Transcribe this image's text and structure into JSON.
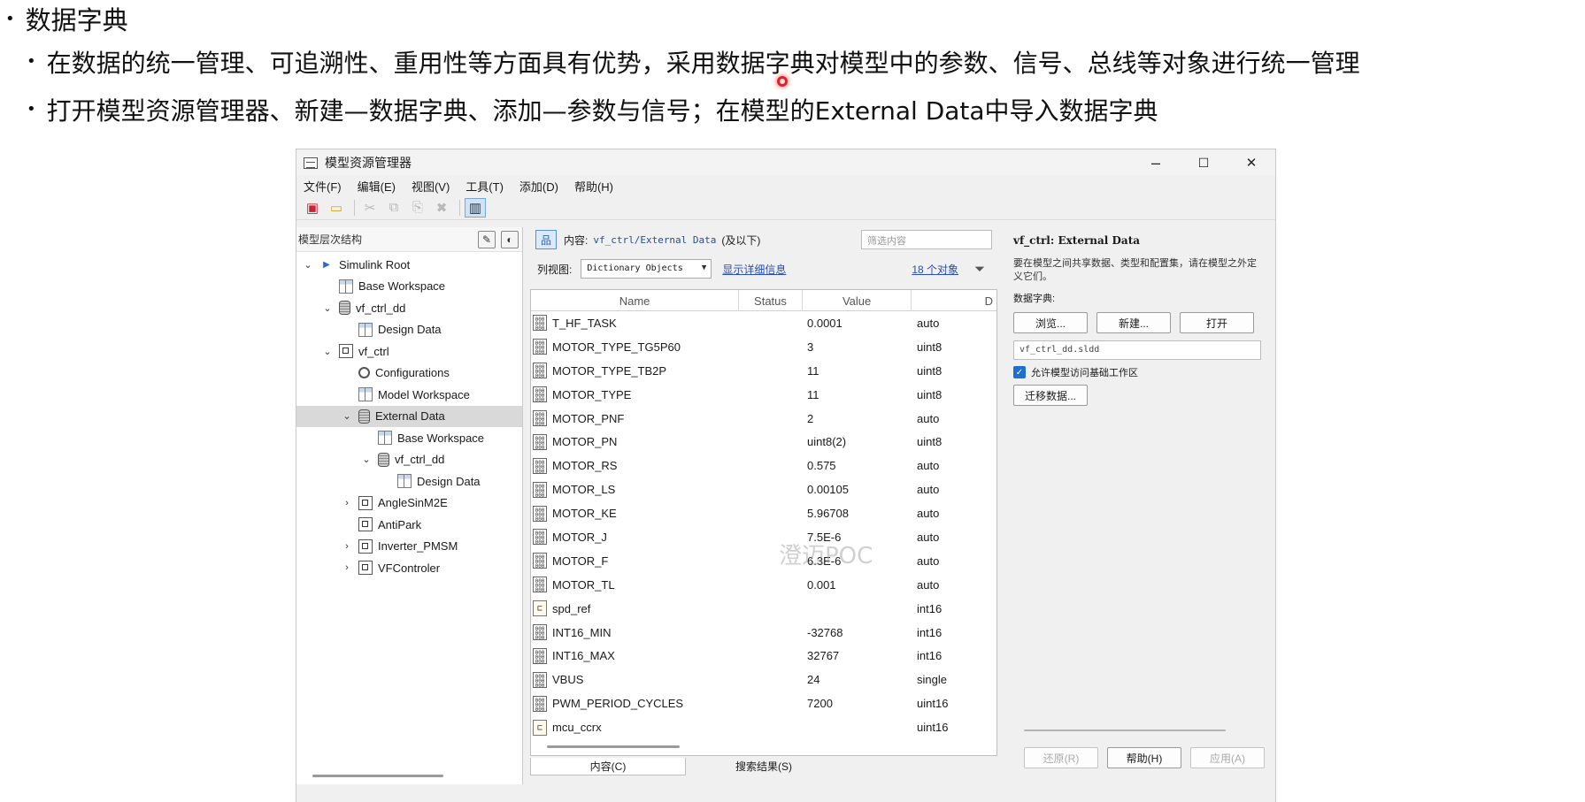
{
  "slide": {
    "bullet1": "数据字典",
    "bullet2": "在数据的统一管理、可追溯性、重用性等方面具有优势，采用数据字典对模型中的参数、信号、总线等对象进行统一管理",
    "bullet3": "打开模型资源管理器、新建—数据字典、添加—参数与信号；在模型的External Data中导入数据字典"
  },
  "window": {
    "title": "模型资源管理器",
    "controls": {
      "minimize": "–",
      "maximize": "☐",
      "close": "✕"
    }
  },
  "menu": [
    "文件(F)",
    "编辑(E)",
    "视图(V)",
    "工具(T)",
    "添加(D)",
    "帮助(H)"
  ],
  "left_pane": {
    "header": "模型层次结构",
    "tree": [
      {
        "label": "Simulink Root",
        "icon": "root-icon",
        "chevron": "⌄"
      },
      {
        "label": "Base Workspace",
        "icon": "workspace-icon",
        "chevron": ""
      },
      {
        "label": "vf_ctrl_dd",
        "icon": "dictionary-icon",
        "chevron": "⌄"
      },
      {
        "label": "Design Data",
        "icon": "workspace-icon",
        "chevron": ""
      },
      {
        "label": "vf_ctrl",
        "icon": "model-icon",
        "chevron": "⌄"
      },
      {
        "label": "Configurations",
        "icon": "gear-icon",
        "chevron": ""
      },
      {
        "label": "Model Workspace",
        "icon": "workspace-icon",
        "chevron": ""
      },
      {
        "label": "External Data",
        "icon": "dictionary-icon",
        "chevron": "⌄"
      },
      {
        "label": "Base Workspace",
        "icon": "workspace-icon",
        "chevron": ""
      },
      {
        "label": "vf_ctrl_dd",
        "icon": "dictionary-icon",
        "chevron": "⌄"
      },
      {
        "label": "Design Data",
        "icon": "workspace-icon",
        "chevron": ""
      },
      {
        "label": "AngleSinM2E",
        "icon": "model-icon",
        "chevron": "›"
      },
      {
        "label": "AntiPark",
        "icon": "model-icon",
        "chevron": ""
      },
      {
        "label": "Inverter_PMSM",
        "icon": "model-icon",
        "chevron": "›"
      },
      {
        "label": "VFControler",
        "icon": "model-icon",
        "chevron": "›"
      }
    ]
  },
  "center_pane": {
    "content_label": "内容:",
    "content_path": "vf_ctrl/External Data",
    "content_suffix": "(及以下)",
    "filter_placeholder": "筛选内容",
    "view_label": "列视图:",
    "view_value": "Dictionary Objects",
    "details_link": "显示详细信息",
    "count_link": "18 个对象",
    "columns": [
      "Name",
      "Status",
      "Value",
      "D"
    ],
    "rows": [
      {
        "name": "T_HF_TASK",
        "kind": "param",
        "value": "0.0001",
        "type": "auto"
      },
      {
        "name": "MOTOR_TYPE_TG5P60",
        "kind": "param",
        "value": "3",
        "type": "uint8"
      },
      {
        "name": "MOTOR_TYPE_TB2P",
        "kind": "param",
        "value": "11",
        "type": "uint8"
      },
      {
        "name": "MOTOR_TYPE",
        "kind": "param",
        "value": "11",
        "type": "uint8"
      },
      {
        "name": "MOTOR_PNF",
        "kind": "param",
        "value": "2",
        "type": "auto"
      },
      {
        "name": "MOTOR_PN",
        "kind": "param",
        "value": "uint8(2)",
        "type": "uint8"
      },
      {
        "name": "MOTOR_RS",
        "kind": "param",
        "value": "0.575",
        "type": "auto"
      },
      {
        "name": "MOTOR_LS",
        "kind": "param",
        "value": "0.00105",
        "type": "auto"
      },
      {
        "name": "MOTOR_KE",
        "kind": "param",
        "value": "5.96708",
        "type": "auto"
      },
      {
        "name": "MOTOR_J",
        "kind": "param",
        "value": "7.5E-6",
        "type": "auto"
      },
      {
        "name": "MOTOR_F",
        "kind": "param",
        "value": "6.3E-6",
        "type": "auto"
      },
      {
        "name": "MOTOR_TL",
        "kind": "param",
        "value": "0.001",
        "type": "auto"
      },
      {
        "name": "spd_ref",
        "kind": "signal",
        "value": "",
        "type": "int16"
      },
      {
        "name": "INT16_MIN",
        "kind": "param",
        "value": "-32768",
        "type": "int16"
      },
      {
        "name": "INT16_MAX",
        "kind": "param",
        "value": "32767",
        "type": "int16"
      },
      {
        "name": "VBUS",
        "kind": "param",
        "value": "24",
        "type": "single"
      },
      {
        "name": "PWM_PERIOD_CYCLES",
        "kind": "param",
        "value": "7200",
        "type": "uint16"
      },
      {
        "name": "mcu_ccrx",
        "kind": "signal",
        "value": "",
        "type": "uint16"
      }
    ],
    "tabs": [
      "内容(C)",
      "搜索结果(S)"
    ],
    "watermark": "澄迈POC"
  },
  "right_pane": {
    "title": "vf_ctrl: External Data",
    "description": "要在模型之间共享数据、类型和配置集，请在模型之外定义它们。",
    "dict_label": "数据字典:",
    "browse": "浏览...",
    "new": "新建...",
    "open": "打开",
    "dict_path": "vf_ctrl_dd.sldd",
    "allow_base": "允许模型访问基础工作区",
    "migrate": "迁移数据...",
    "revert": "还原(R)",
    "help": "帮助(H)",
    "apply": "应用(A)"
  }
}
